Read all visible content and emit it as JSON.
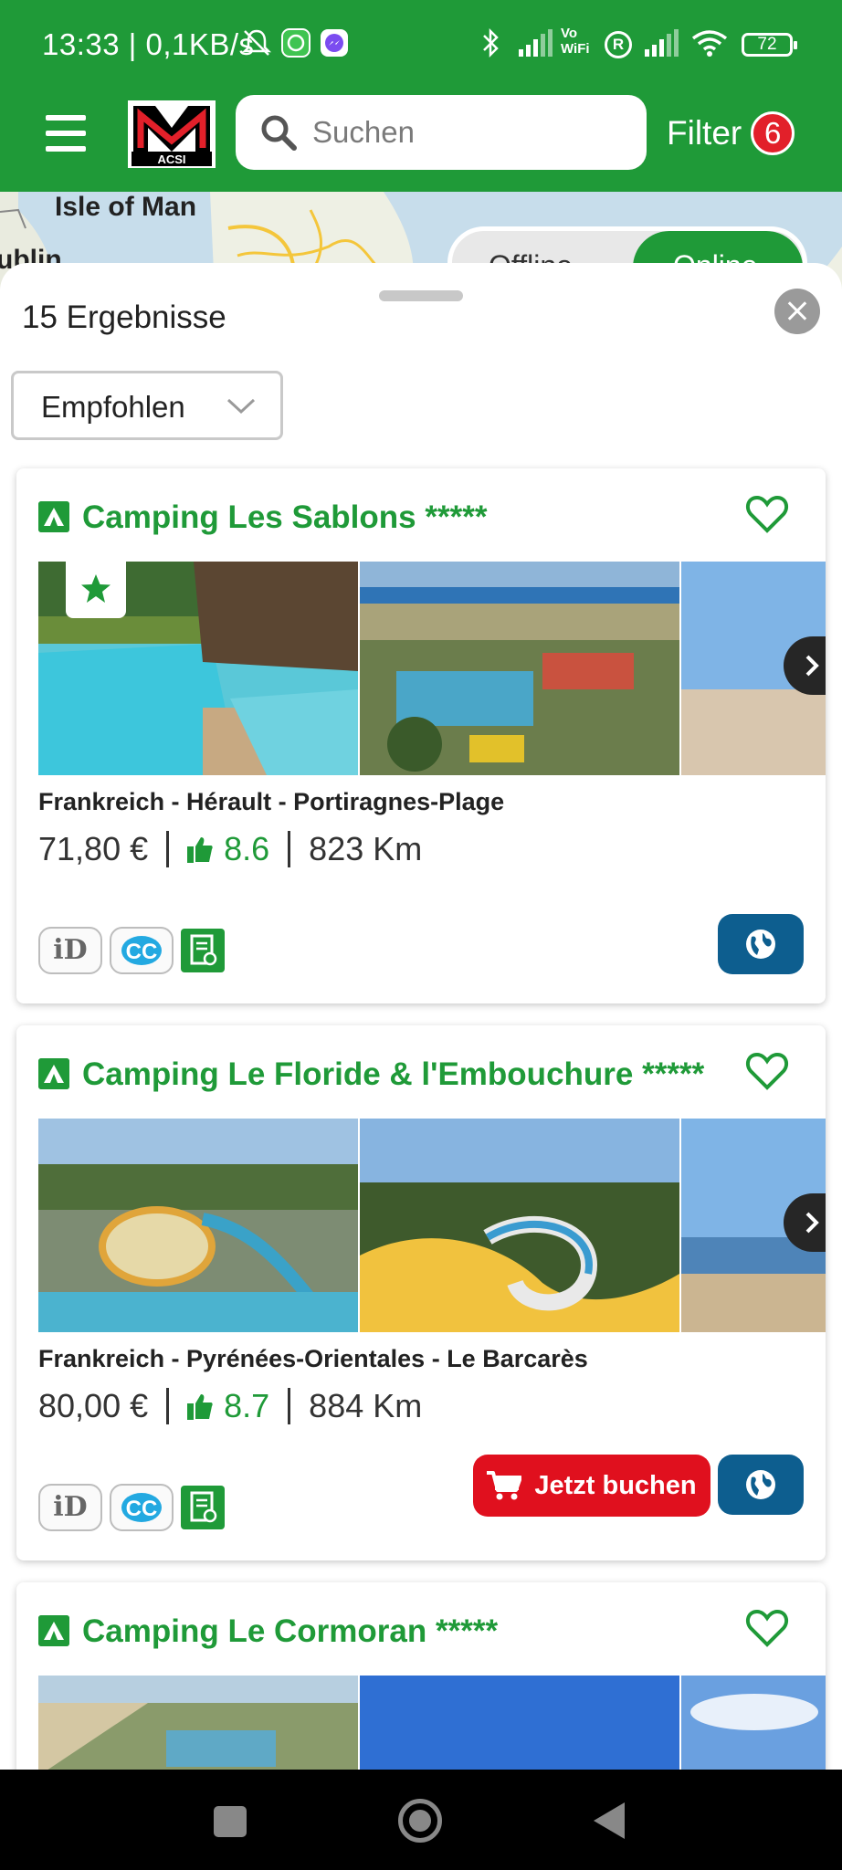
{
  "status_bar": {
    "time_speed": "13:33 | 0,1KB/s",
    "volte_label": "Vo WiFi",
    "roaming_label": "R",
    "battery": "72"
  },
  "header": {
    "logo_text": "ACSI",
    "search_placeholder": "Suchen",
    "filter_label": "Filter",
    "filter_count": "6"
  },
  "map": {
    "labels": [
      "Isle of Man",
      "ublin"
    ],
    "toggle_offline": "Offline",
    "toggle_online": "Online"
  },
  "sheet": {
    "results_label": "15 Ergebnisse",
    "sort_label": "Empfohlen"
  },
  "cards": [
    {
      "name": "Camping Les Sablons *****",
      "location": "Frankreich  - Hérault - Portiragnes-Plage",
      "price": "71,80 €",
      "rating": "8.6",
      "distance": "823 Km",
      "features": [
        "iD",
        "CC",
        "document"
      ],
      "book_label": ""
    },
    {
      "name": "Camping Le Floride & l'Embouchure *****",
      "location": "Frankreich  - Pyrénées-Orientales - Le Barcarès",
      "price": "80,00 €",
      "rating": "8.7",
      "distance": "884 Km",
      "features": [
        "iD",
        "CC",
        "document"
      ],
      "book_label": "Jetzt buchen"
    },
    {
      "name": "Camping Le Cormoran *****"
    }
  ],
  "colors": {
    "brand_green": "#1f9a38",
    "book_red": "#e0101e",
    "web_blue": "#0d5e8f",
    "badge_red": "#e2202a"
  },
  "icons": [
    "hamburger-icon",
    "search-icon",
    "heart-icon",
    "star-icon",
    "chevron-right-icon",
    "thumbs-up-icon",
    "globe-icon",
    "cart-icon",
    "chevron-down-icon",
    "close-icon",
    "tent-icon"
  ]
}
